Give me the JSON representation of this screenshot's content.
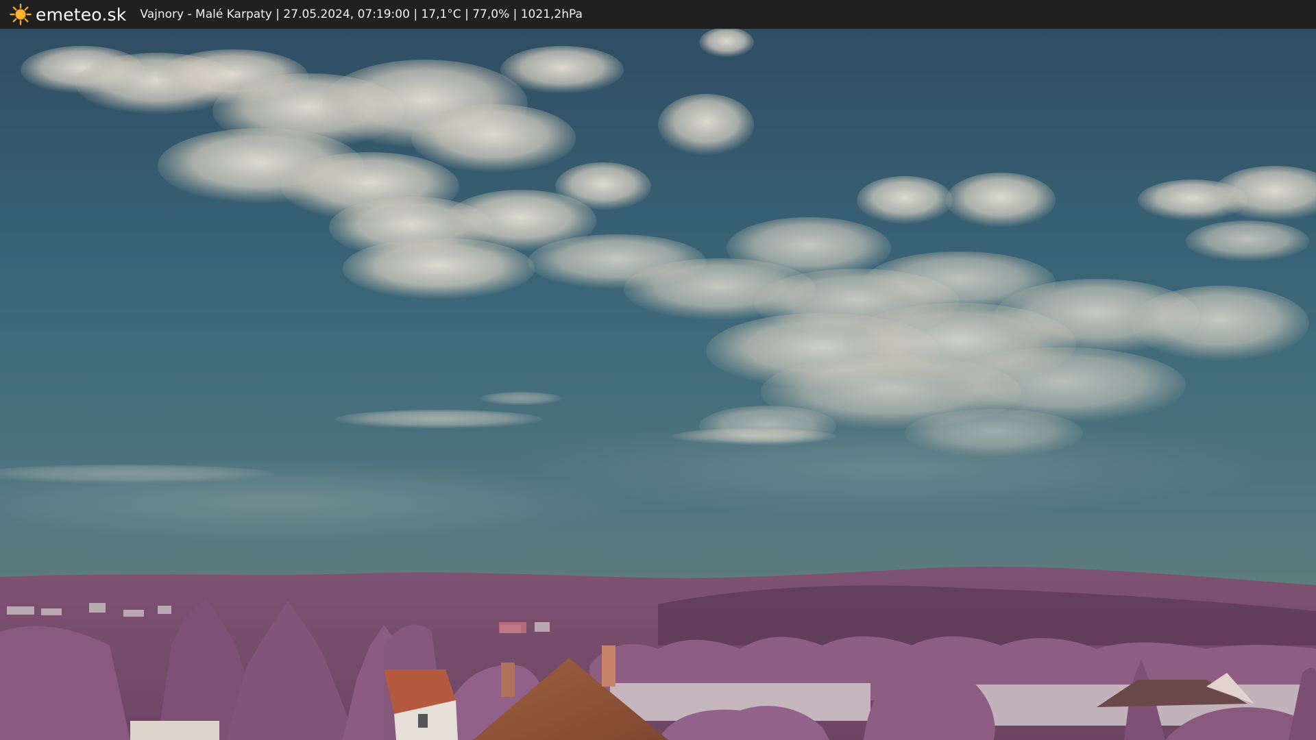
{
  "header": {
    "brand": "emeteo.sk",
    "caption": "Vajnory - Malé Karpaty | 27.05.2024, 07:19:00 | 17,1°C | 77,0% | 1021,2hPa",
    "logo_icon": "sun-icon"
  },
  "colors": {
    "bar": "#202020",
    "sun": "#f5a623",
    "sky_top": "#355468",
    "sky_bottom": "#5f7a7a",
    "hills": "#8a5a7c",
    "trees": "#9a6a8c",
    "roof": "#9a5a3c"
  }
}
